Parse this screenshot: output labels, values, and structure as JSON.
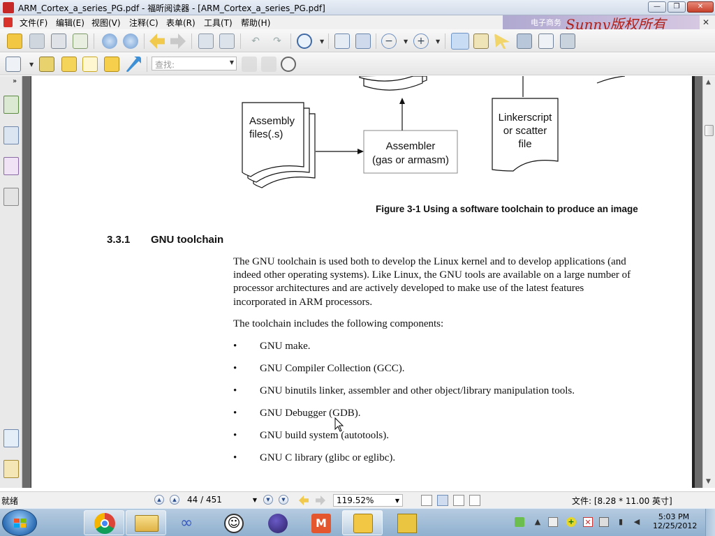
{
  "window": {
    "title": "ARM_Cortex_a_series_PG.pdf - 福昕阅读器 - [ARM_Cortex_a_series_PG.pdf]",
    "min_label": "—",
    "max_label": "❐",
    "close_label": "✕"
  },
  "menu": {
    "items": [
      "文件(F)",
      "编辑(E)",
      "视图(V)",
      "注释(C)",
      "表单(R)",
      "工具(T)",
      "帮助(H)"
    ],
    "banner_text": "电子商务",
    "watermark": "Sunny版权所有",
    "doc_close_label": "✕"
  },
  "toolbar": {
    "search_placeholder": "查找:"
  },
  "document": {
    "diagram": {
      "assembly_files": [
        "Assembly",
        "files(.s)"
      ],
      "assembler": [
        "Assembler",
        "(gas or armasm)"
      ],
      "linkerscript": [
        "Linkerscript",
        "or scatter",
        "file"
      ]
    },
    "figure_caption": "Figure 3-1 Using a software toolchain to produce an image",
    "section_number": "3.3.1",
    "section_title": "GNU toolchain",
    "paragraph_lines": [
      "The GNU toolchain is used both to develop the Linux kernel and to develop applications (and",
      "indeed other operating systems). Like Linux, the GNU tools are available on a large number of",
      "processor architectures and are actively developed to make use of the latest features",
      "incorporated in ARM processors."
    ],
    "components_intro": "The toolchain includes the following components:",
    "bullet": "•",
    "components": [
      "GNU make.",
      "GNU Compiler Collection (GCC).",
      "GNU binutils linker, assembler and other object/library manipulation tools.",
      "GNU Debugger (GDB).",
      "GNU build system (autotools).",
      "GNU C library (glibc or eglibc)."
    ]
  },
  "statusbar": {
    "status": "就绪",
    "page_indicator": "44 / 451",
    "current_page": 44,
    "total_pages": 451,
    "zoom": "119.52%",
    "page_size": "文件: [8.28 * 11.00 英寸]"
  },
  "taskbar": {
    "time": "5:03 PM",
    "date": "12/25/2012",
    "apps": [
      "chrome-icon",
      "file-explorer-icon",
      "infinity-app-icon",
      "smiley-app-icon",
      "eclipse-icon",
      "mindmanager-icon",
      "foxit-reader-icon",
      "puzzle-app-icon"
    ]
  },
  "colors": {
    "title_gradient": "#d2dcea",
    "page_background": "#ffffff",
    "doc_background": "#6b6b6b",
    "watermark": "#b0201a",
    "taskbar": "#8fb0cf"
  }
}
